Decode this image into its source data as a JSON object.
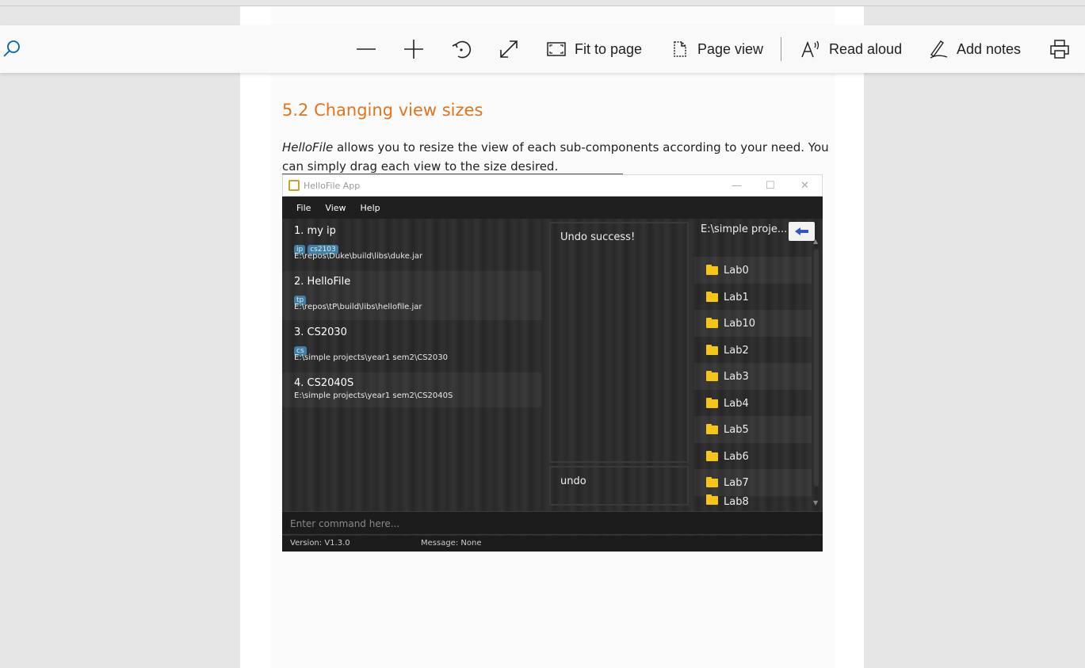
{
  "toolbar": {
    "zoom_out_label": "",
    "fit_to_page": "Fit to page",
    "page_view": "Page view",
    "read_aloud": "Read aloud",
    "add_notes": "Add notes"
  },
  "document": {
    "heading": "5.2 Changing view sizes",
    "para_italic": "HelloFile",
    "para_rest": " allows you to resize the view of each sub-components according to your need. You can simply drag each view to the size desired."
  },
  "app": {
    "title": "HelloFile App",
    "menu": [
      "File",
      "View",
      "Help"
    ],
    "items": [
      {
        "name": "1.  my ip",
        "tags": [
          "ip",
          "cs2103"
        ],
        "path": "E:\\repos\\Duke\\build\\libs\\duke.jar"
      },
      {
        "name": "2.  HelloFile",
        "tags": [
          "tp"
        ],
        "path": "E:\\repos\\tP\\build\\libs\\hellofile.jar"
      },
      {
        "name": "3.  CS2030",
        "tags": [
          "cs"
        ],
        "path": "E:\\simple projects\\year1 sem2\\CS2030"
      },
      {
        "name": "4.  CS2040S",
        "tags": [],
        "path": "E:\\simple projects\\year1 sem2\\CS2040S"
      }
    ],
    "result_text": "Undo success!",
    "last_command": "undo",
    "current_dir": "E:\\simple proje...",
    "folders": [
      "Lab0",
      "Lab1",
      "Lab10",
      "Lab2",
      "Lab3",
      "Lab4",
      "Lab5",
      "Lab6",
      "Lab7",
      "Lab8"
    ],
    "command_placeholder": "Enter command here...",
    "version": "Version:  V1.3.0",
    "message": "Message:  None"
  },
  "colors": {
    "heading": "#e3731c",
    "tag": "#3e7fa6",
    "folder": "#f5c518"
  }
}
